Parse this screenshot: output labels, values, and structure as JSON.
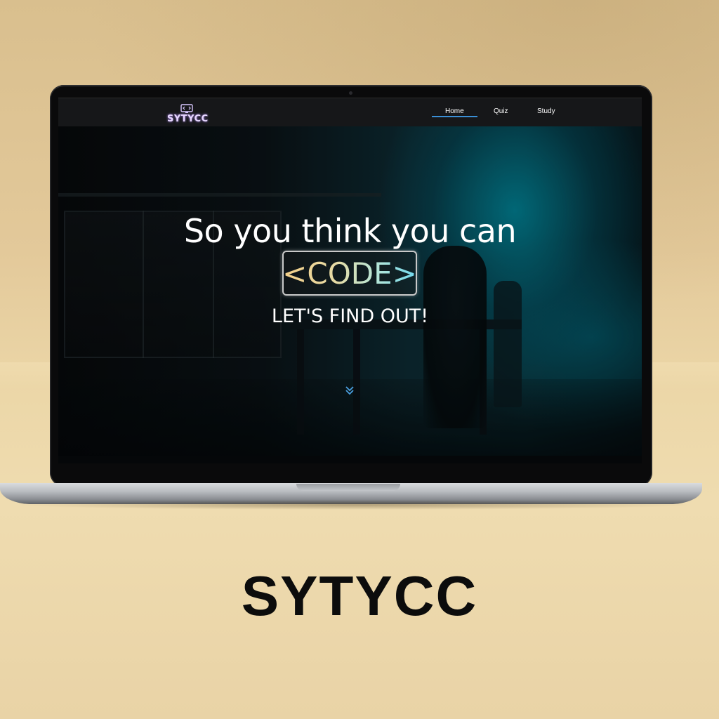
{
  "navbar": {
    "logo_text": "SYTYCC",
    "items": [
      {
        "label": "Home",
        "active": true
      },
      {
        "label": "Quiz",
        "active": false
      },
      {
        "label": "Study",
        "active": false
      }
    ],
    "active_color": "#3a8fd6"
  },
  "hero": {
    "title": "So you think you can",
    "code_word": "<CODE>",
    "subtitle": "LET'S FIND OUT!",
    "scroll_icon": "chevron-double-down-icon"
  },
  "caption": "SYTYCC",
  "colors": {
    "background": "#e8d2a4",
    "accent": "#3a8fd6",
    "code_gradient_start": "#f4cf88",
    "code_gradient_end": "#6fd8ee"
  }
}
